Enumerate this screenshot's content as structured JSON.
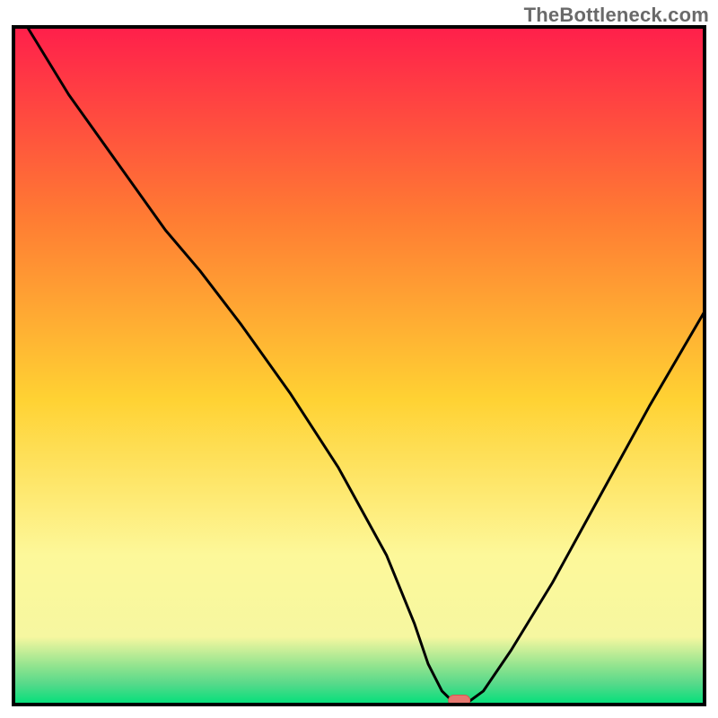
{
  "watermark": {
    "text": "TheBottleneck.com"
  },
  "colors": {
    "top": "#ff1f4b",
    "mid_upper": "#ff7b33",
    "mid": "#ffd233",
    "pale_yellow": "#fdf89a",
    "near_bottom_yellow": "#f6f7a0",
    "green_band_top": "#8de38e",
    "green_band_mid": "#55d98a",
    "green_bottom": "#00e07a",
    "curve": "#000000",
    "marker_fill": "#e6776f",
    "marker_stroke": "#d8564f",
    "frame": "#000000"
  },
  "chart_data": {
    "type": "line",
    "title": "",
    "xlabel": "",
    "ylabel": "",
    "xlim": [
      0,
      100
    ],
    "ylim": [
      0,
      100
    ],
    "grid": false,
    "legend": false,
    "series": [
      {
        "name": "bottleneck-curve",
        "x": [
          2,
          8,
          15,
          22,
          27,
          33,
          40,
          47,
          54,
          58,
          60,
          62,
          63.5,
          66,
          68,
          72,
          78,
          85,
          92,
          100
        ],
        "y": [
          100,
          90,
          80,
          70,
          64,
          56,
          46,
          35,
          22,
          12,
          6,
          2,
          0.5,
          0.5,
          2,
          8,
          18,
          31,
          44,
          58
        ],
        "note": "Asymmetric V-shaped curve; steep descent from top-left, minimum (flat segment) near x≈63-66%, then rising to ~58% at right edge. Y-values read against the vertical gradient height (0=bottom, 100=top)."
      }
    ],
    "marker": {
      "x": 64.5,
      "y": 0.6,
      "shape": "rounded-pill",
      "note": "Small salmon-red pill marking the optimum point on the baseline."
    },
    "background_gradient": {
      "stops": [
        {
          "pos": 0.0,
          "color": "#ff1f4b"
        },
        {
          "pos": 0.28,
          "color": "#ff7b33"
        },
        {
          "pos": 0.55,
          "color": "#ffd233"
        },
        {
          "pos": 0.78,
          "color": "#fdf89a"
        },
        {
          "pos": 0.9,
          "color": "#f6f7a0"
        },
        {
          "pos": 0.945,
          "color": "#8de38e"
        },
        {
          "pos": 0.97,
          "color": "#55d98a"
        },
        {
          "pos": 1.0,
          "color": "#00e07a"
        }
      ]
    }
  }
}
